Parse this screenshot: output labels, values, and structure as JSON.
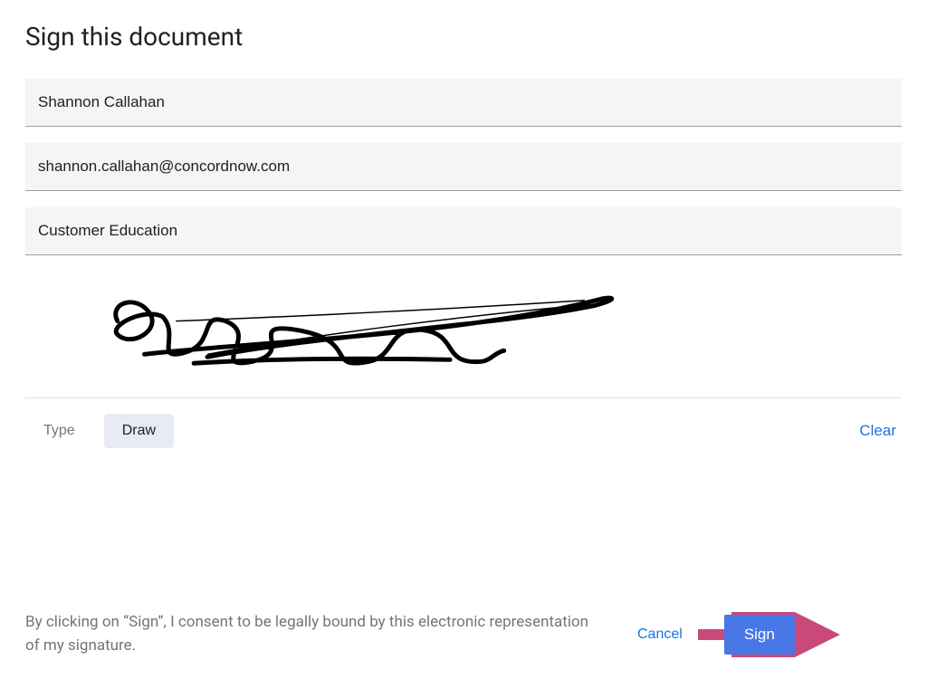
{
  "title": "Sign this document",
  "fields": {
    "name": "Shannon Callahan",
    "email": "shannon.callahan@concordnow.com",
    "company": "Customer Education"
  },
  "modes": {
    "type_label": "Type",
    "draw_label": "Draw",
    "active": "draw"
  },
  "clear_label": "Clear",
  "consent_text": "By clicking on “Sign”, I consent to be legally bound by this electronic representation of my signature.",
  "cancel_label": "Cancel",
  "sign_label": "Sign"
}
